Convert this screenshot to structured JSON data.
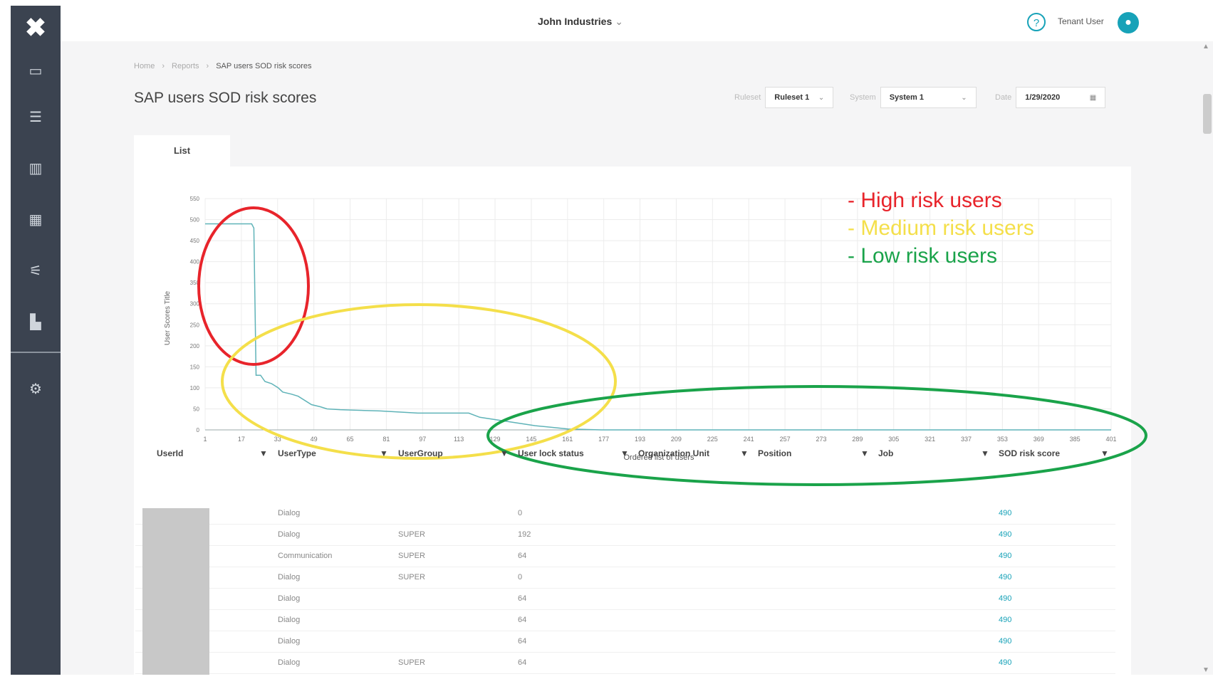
{
  "header": {
    "company": "John Industries",
    "user_name": "Tenant User"
  },
  "icons": {
    "logo": "logo-icon",
    "nav": [
      "monitor-icon",
      "list-icon",
      "analytics-icon",
      "dashboard-icon",
      "workflow-icon",
      "reports-icon",
      "settings-icon"
    ],
    "help": "help-icon",
    "avatar": "user-avatar-icon",
    "column_filter": "filter-icon"
  },
  "breadcrumb": [
    "Home",
    "Reports",
    "SAP users SOD risk scores"
  ],
  "page_title": "SAP users SOD risk scores",
  "filters": {
    "ruleset_label": "Ruleset",
    "ruleset_value": "Ruleset 1",
    "system_label": "System",
    "system_value": "System 1",
    "date_label": "Date",
    "date_value": "1/29/2020"
  },
  "tabs": [
    "List"
  ],
  "annotation_legend": [
    {
      "text": "- High risk users",
      "color": "#e8242b"
    },
    {
      "text": "- Medium risk users",
      "color": "#f4df4a"
    },
    {
      "text": "- Low risk users",
      "color": "#1aa34a"
    }
  ],
  "chart_data": {
    "type": "line",
    "xlabel": "Ordered list of users",
    "ylabel": "User Scores Title",
    "x_ticks": [
      "1",
      "17",
      "33",
      "49",
      "65",
      "81",
      "97",
      "113",
      "129",
      "145",
      "161",
      "177",
      "193",
      "209",
      "225",
      "241",
      "257",
      "273",
      "289",
      "305",
      "321",
      "337",
      "353",
      "369",
      "385",
      "401"
    ],
    "y_ticks": [
      "0",
      "50",
      "100",
      "150",
      "200",
      "250",
      "300",
      "350",
      "400",
      "450",
      "500",
      "550"
    ],
    "xlim": [
      1,
      410
    ],
    "ylim": [
      0,
      550
    ],
    "series": [
      {
        "color": "#5fb3b8",
        "x": [
          1,
          22,
          23,
          24,
          26,
          28,
          31,
          34,
          36,
          40,
          43,
          49,
          53,
          56,
          62,
          80,
          97,
          120,
          125,
          150,
          165,
          180,
          260,
          410
        ],
        "y": [
          490,
          490,
          480,
          130,
          130,
          115,
          110,
          100,
          90,
          85,
          80,
          60,
          55,
          50,
          48,
          45,
          40,
          40,
          30,
          10,
          2,
          0,
          0,
          0
        ]
      }
    ]
  },
  "table": {
    "columns": [
      "UserId",
      "UserType",
      "UserGroup",
      "User lock status",
      "Organization Unit",
      "Position",
      "Job",
      "SOD risk score"
    ],
    "rows": [
      [
        "",
        "Dialog",
        "",
        "0",
        "",
        "",
        "",
        "490"
      ],
      [
        "",
        "Dialog",
        "SUPER",
        "192",
        "",
        "",
        "",
        "490"
      ],
      [
        "",
        "Communication",
        "SUPER",
        "64",
        "",
        "",
        "",
        "490"
      ],
      [
        "",
        "Dialog",
        "SUPER",
        "0",
        "",
        "",
        "",
        "490"
      ],
      [
        "",
        "Dialog",
        "",
        "64",
        "",
        "",
        "",
        "490"
      ],
      [
        "",
        "Dialog",
        "",
        "64",
        "",
        "",
        "",
        "490"
      ],
      [
        "",
        "Dialog",
        "",
        "64",
        "",
        "",
        "",
        "490"
      ],
      [
        "",
        "Dialog",
        "SUPER",
        "64",
        "",
        "",
        "",
        "490"
      ]
    ]
  }
}
